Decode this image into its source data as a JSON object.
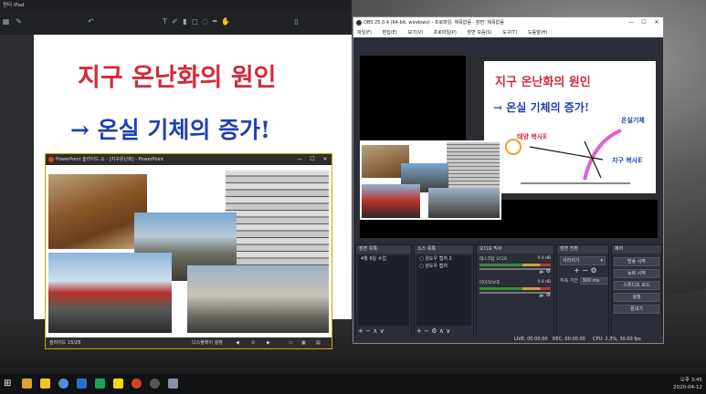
{
  "ipad": {
    "title": "윈터 iPad",
    "line1": "지구 온난화의 원인",
    "line2": "→ 온실 기체의 증가!"
  },
  "ppt": {
    "title": "PowerPoint 슬라이드 쇼 - [지구온난화] - PowerPoint",
    "slide_label": "슬라이드 15/26",
    "display_label": "디스플레이 설정"
  },
  "obs": {
    "title": "OBS 25.0.4 (64-bit, windows) - 프로파일: 제목없음 - 장면: 제목없음",
    "menu": [
      "파일(F)",
      "편집(E)",
      "보기(V)",
      "프로파일(P)",
      "장면 모음(S)",
      "도구(T)",
      "도움말(H)"
    ],
    "preview": {
      "line1": "지구 온난화의 원인",
      "line2": "→ 온실 기체의 증가!",
      "label_sun": "태양 복사E",
      "label_gas": "온실기체",
      "label_earth": "지구 복사E"
    },
    "scenes": {
      "header": "장면 목록",
      "items": [
        "4월 9일 수업"
      ]
    },
    "sources": {
      "header": "소스 목록",
      "items": [
        "윈도우 캡처 2",
        "윈도우 캡처"
      ]
    },
    "mixer": {
      "header": "오디오 믹서",
      "ch1_name": "데스크탑 오디오",
      "ch1_db": "0.0 dB",
      "ch2_name": "마이크/보조",
      "ch2_db": "0.0 dB"
    },
    "transitions": {
      "header": "장면 전환",
      "selected": "사라지기",
      "duration_label": "지속 기간",
      "duration_value": "300 ms"
    },
    "controls": {
      "header": "제어",
      "buttons": [
        "방송 시작",
        "녹화 시작",
        "스튜디오 모드",
        "설정",
        "끝내기"
      ]
    },
    "status": {
      "live": "LIVE: 00:00:00",
      "rec": "REC: 00:00:00",
      "cpu": "CPU: 2.3%, 30.00 fps"
    }
  },
  "taskbar": {
    "time": "오후 3:45",
    "date": "2020-04-12"
  }
}
